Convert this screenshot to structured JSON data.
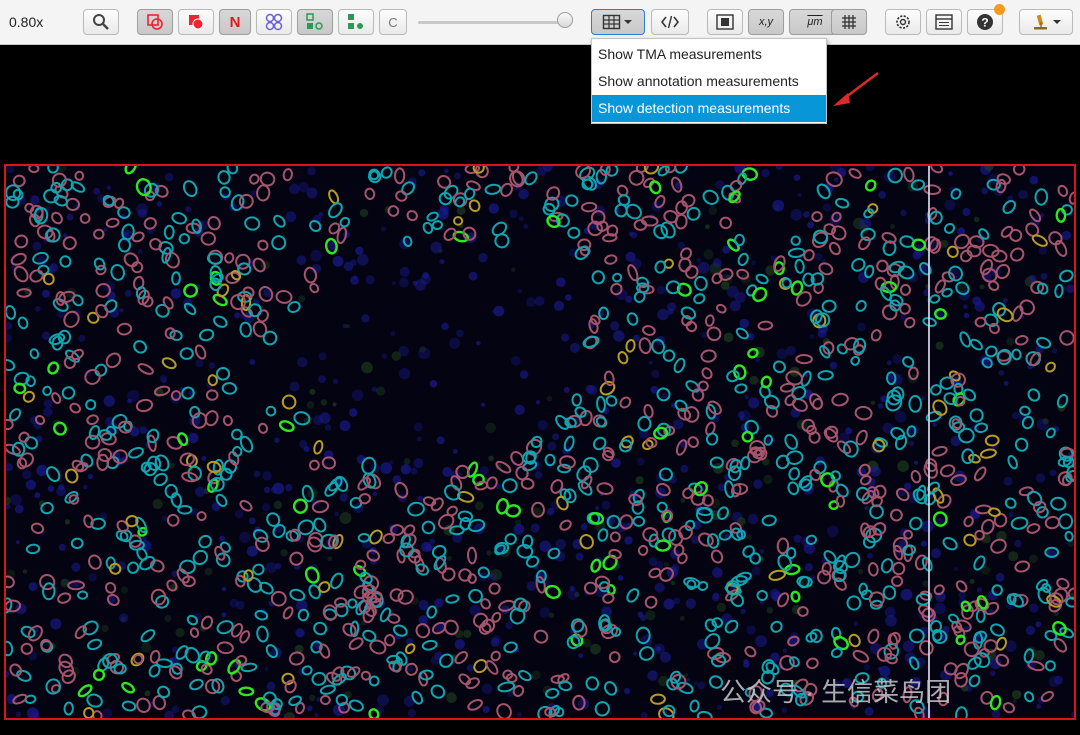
{
  "toolbar": {
    "zoom_label": "0.80x",
    "tool_c_label": "C",
    "counting_n_label": "N",
    "coords_label": "x,y",
    "microns_label": "μm"
  },
  "measurement_menu": {
    "items": [
      {
        "label": "Show TMA measurements",
        "active": false
      },
      {
        "label": "Show annotation measurements",
        "active": false
      },
      {
        "label": "Show detection measurements",
        "active": true
      }
    ]
  },
  "colors": {
    "accent": "#0796d8",
    "annotation": "#d8141c",
    "arrow": "#e02a2a",
    "cells": [
      "#0fa6b0",
      "#a5546c",
      "#2ee81e",
      "#b79c22"
    ]
  },
  "watermark": "公众号 · 生信菜鸟团"
}
